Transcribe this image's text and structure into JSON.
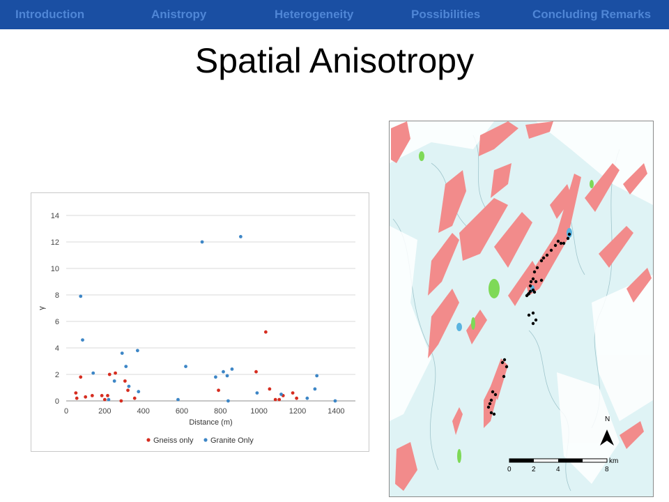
{
  "nav": {
    "items": [
      {
        "label": "Introduction",
        "active": false
      },
      {
        "label": "Anistropy",
        "active": true
      },
      {
        "label": "Heterogeneity",
        "active": false
      },
      {
        "label": "Possibilities",
        "active": false
      },
      {
        "label": "Concluding Remarks",
        "active": false
      }
    ]
  },
  "slide": {
    "title": "Spatial Anisotropy"
  },
  "colors": {
    "nav_bg": "#1a4fa3",
    "nav_inactive": "#4f86d6",
    "nav_active": "#ffffff",
    "gneiss": "#d62d20",
    "granite": "#3d86c6",
    "map_water": "#dff3f5",
    "map_granite": "#f28b8b",
    "map_green": "#7ed957",
    "map_blue": "#5ab4e0"
  },
  "chart_data": {
    "type": "scatter",
    "title": "",
    "xlabel": "Distance (m)",
    "ylabel": "γ",
    "xlim": [
      0,
      1500
    ],
    "ylim": [
      0,
      14
    ],
    "xticks": [
      0,
      200,
      400,
      600,
      800,
      1000,
      1200,
      1400
    ],
    "yticks": [
      0,
      2,
      4,
      6,
      8,
      10,
      12,
      14
    ],
    "grid": "horizontal",
    "legend": "bottom",
    "series": [
      {
        "name": "Gneiss only",
        "color": "#d62d20",
        "points": [
          [
            50,
            0.6
          ],
          [
            55,
            0.2
          ],
          [
            75,
            1.8
          ],
          [
            100,
            0.3
          ],
          [
            135,
            0.4
          ],
          [
            185,
            0.4
          ],
          [
            200,
            0.1
          ],
          [
            215,
            0.4
          ],
          [
            225,
            2.0
          ],
          [
            255,
            2.1
          ],
          [
            285,
            0.0
          ],
          [
            305,
            1.5
          ],
          [
            320,
            0.8
          ],
          [
            355,
            0.2
          ],
          [
            790,
            0.8
          ],
          [
            985,
            2.2
          ],
          [
            1035,
            5.2
          ],
          [
            1055,
            0.9
          ],
          [
            1085,
            0.1
          ],
          [
            1105,
            0.1
          ],
          [
            1125,
            0.4
          ],
          [
            1175,
            0.6
          ],
          [
            1195,
            0.2
          ]
        ]
      },
      {
        "name": "Granite Only",
        "color": "#3d86c6",
        "points": [
          [
            75,
            7.9
          ],
          [
            85,
            4.6
          ],
          [
            140,
            2.1
          ],
          [
            220,
            0.1
          ],
          [
            250,
            1.5
          ],
          [
            290,
            3.6
          ],
          [
            310,
            2.6
          ],
          [
            325,
            1.1
          ],
          [
            370,
            3.8
          ],
          [
            375,
            0.7
          ],
          [
            580,
            0.1
          ],
          [
            620,
            2.6
          ],
          [
            705,
            12.0
          ],
          [
            775,
            1.8
          ],
          [
            815,
            2.2
          ],
          [
            835,
            1.9
          ],
          [
            840,
            0.0
          ],
          [
            860,
            2.4
          ],
          [
            905,
            12.4
          ],
          [
            990,
            0.6
          ],
          [
            1115,
            0.5
          ],
          [
            1250,
            0.2
          ],
          [
            1290,
            0.9
          ],
          [
            1300,
            1.9
          ],
          [
            1395,
            0.0
          ]
        ]
      }
    ]
  },
  "map": {
    "scale_unit": "km",
    "scale_labels": [
      "0",
      "2",
      "4",
      "8"
    ],
    "north_label": "N"
  }
}
